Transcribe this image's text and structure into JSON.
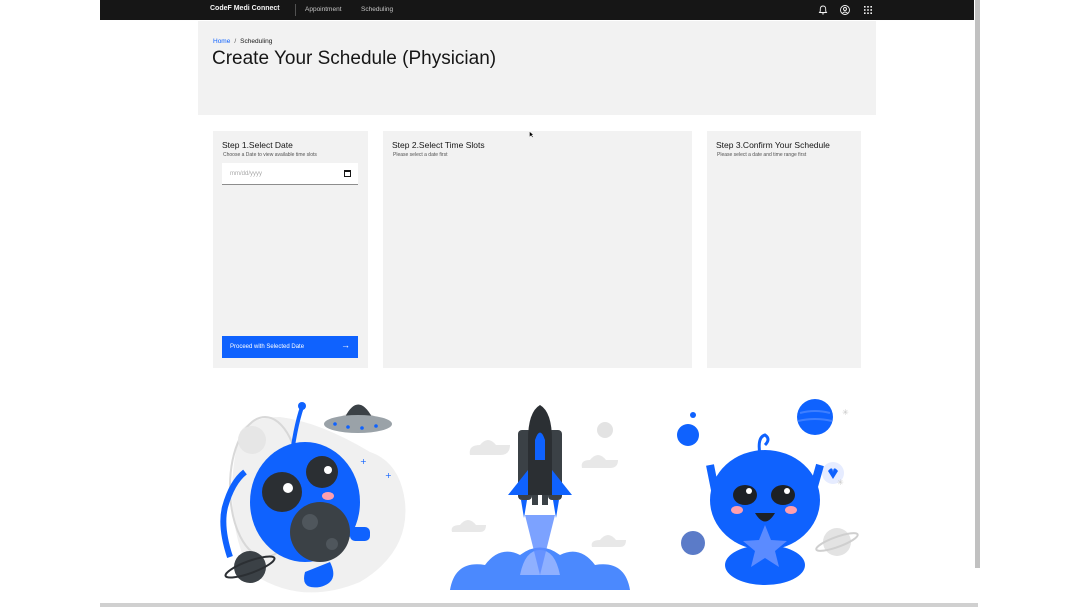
{
  "app": {
    "brand": "CodeF Medi Connect",
    "nav": [
      "Appointment",
      "Scheduling"
    ]
  },
  "header": {
    "breadcrumb": [
      "Home",
      "/",
      "Scheduling"
    ],
    "title": "Create Your Schedule (Physician)"
  },
  "steps": [
    {
      "title": "Step 1.Select Date",
      "subtitle": "Choose a Date to view available time slots"
    },
    {
      "title": "Step 2.Select Time Slots",
      "subtitle": "Please select a date first"
    },
    {
      "title": "Step 3.Confirm Your Schedule",
      "subtitle": "Please select a date and time range first"
    }
  ],
  "date_input": {
    "placeholder": "mm/dd/yyyy"
  },
  "proceed_button": {
    "label": "Proceed with Selected Date"
  },
  "icons": [
    "notification-icon",
    "user-avatar-icon",
    "app-switcher-icon",
    "calendar-icon",
    "arrow-right-icon"
  ],
  "colors": {
    "primary": "#0f62fe",
    "topbar": "#161616",
    "panel": "#f2f2f2"
  }
}
